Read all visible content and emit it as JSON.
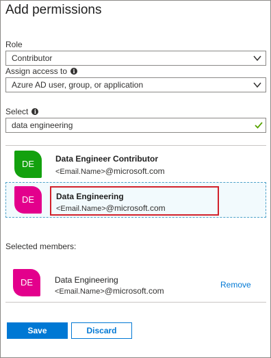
{
  "title": "Add permissions",
  "role": {
    "label": "Role",
    "value": "Contributor"
  },
  "assign_access": {
    "label": "Assign access to",
    "value": "Azure AD user, group, or application"
  },
  "select": {
    "label": "Select",
    "value": "data engineering"
  },
  "results": [
    {
      "initials": "DE",
      "name": "Data Engineer Contributor",
      "email_placeholder": "<Email.Name>",
      "email_domain": "@microsoft.com",
      "avatar_color": "#13a10e"
    },
    {
      "initials": "DE",
      "name": "Data Engineering",
      "email_placeholder": "<Email.Name>",
      "email_domain": "@microsoft.com",
      "avatar_color": "#e3008c"
    }
  ],
  "selected_members": {
    "label": "Selected members:",
    "items": [
      {
        "initials": "DE",
        "name": "Data Engineering",
        "email_placeholder": "<Email.Name>",
        "email_domain": "@microsoft.com",
        "avatar_color": "#e3008c",
        "remove_label": "Remove"
      }
    ]
  },
  "buttons": {
    "save": "Save",
    "discard": "Discard"
  },
  "colors": {
    "accent": "#0078d4",
    "highlight": "#d1202a"
  }
}
